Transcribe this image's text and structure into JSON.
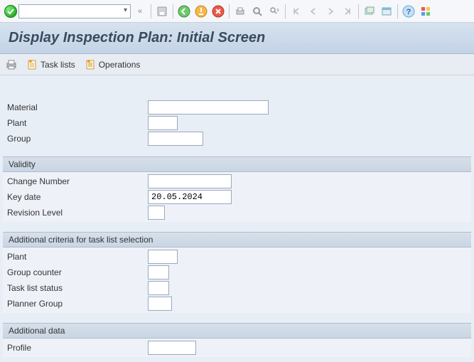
{
  "header": {
    "title": "Display Inspection Plan: Initial Screen"
  },
  "app_toolbar": {
    "task_lists": "Task lists",
    "operations": "Operations"
  },
  "top_fields": {
    "material_label": "Material",
    "material_value": "",
    "plant_label": "Plant",
    "plant_value": "",
    "group_label": "Group",
    "group_value": ""
  },
  "validity": {
    "header": "Validity",
    "change_number_label": "Change Number",
    "change_number_value": "",
    "key_date_label": "Key date",
    "key_date_value": "20.05.2024",
    "revision_level_label": "Revision Level",
    "revision_level_value": ""
  },
  "additional_criteria": {
    "header": "Additional criteria for task list selection",
    "plant_label": "Plant",
    "plant_value": "",
    "group_counter_label": "Group counter",
    "group_counter_value": "",
    "task_list_status_label": "Task list status",
    "task_list_status_value": "",
    "planner_group_label": "Planner Group",
    "planner_group_value": ""
  },
  "additional_data": {
    "header": "Additional data",
    "profile_label": "Profile",
    "profile_value": ""
  }
}
